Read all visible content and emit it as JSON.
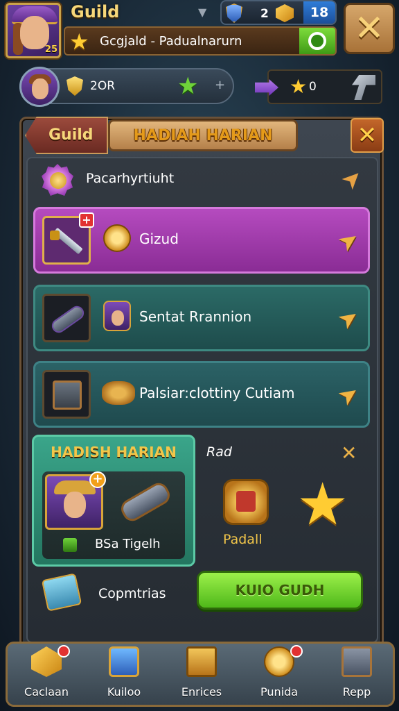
{
  "header": {
    "title": "Guild",
    "player_name": "Gcgjald - Padualnarurn",
    "resource_value": "2",
    "counter": "18",
    "rank_value": "2OR",
    "star_count": "0"
  },
  "panel": {
    "tab_label": "Guild",
    "banner_title": "HADIAH HARIAN",
    "header_label": "Pacarhyrtiuht",
    "rows": [
      {
        "label": "Gizud",
        "color": "#b54bbf"
      },
      {
        "label": "Sentat Rrannion",
        "color": "#2b6a66"
      },
      {
        "label": "Palsiar:clottiny Cutiam",
        "color": "#2b6266"
      }
    ]
  },
  "reward": {
    "title": "HADISH HARIAN",
    "item_name": "BSa Tigelh",
    "side_label": "Rad",
    "pad_label": "Padall",
    "gem_label": "Copmtrias",
    "claim_button": "KUIO GUDH"
  },
  "bottom_nav": [
    {
      "label": "Caclaan",
      "icon": "gold-cube-icon",
      "badge": true
    },
    {
      "label": "Kuiloo",
      "icon": "shield-icon",
      "badge": false
    },
    {
      "label": "Enrices",
      "icon": "chest-icon",
      "badge": false
    },
    {
      "label": "Punida",
      "icon": "coin-icon",
      "badge": true
    },
    {
      "label": "Repp",
      "icon": "box-icon",
      "badge": false
    }
  ],
  "colors": {
    "gold": "#f6d77a",
    "claim_green": "#6fd23a",
    "panel_brown": "#6b5238"
  }
}
